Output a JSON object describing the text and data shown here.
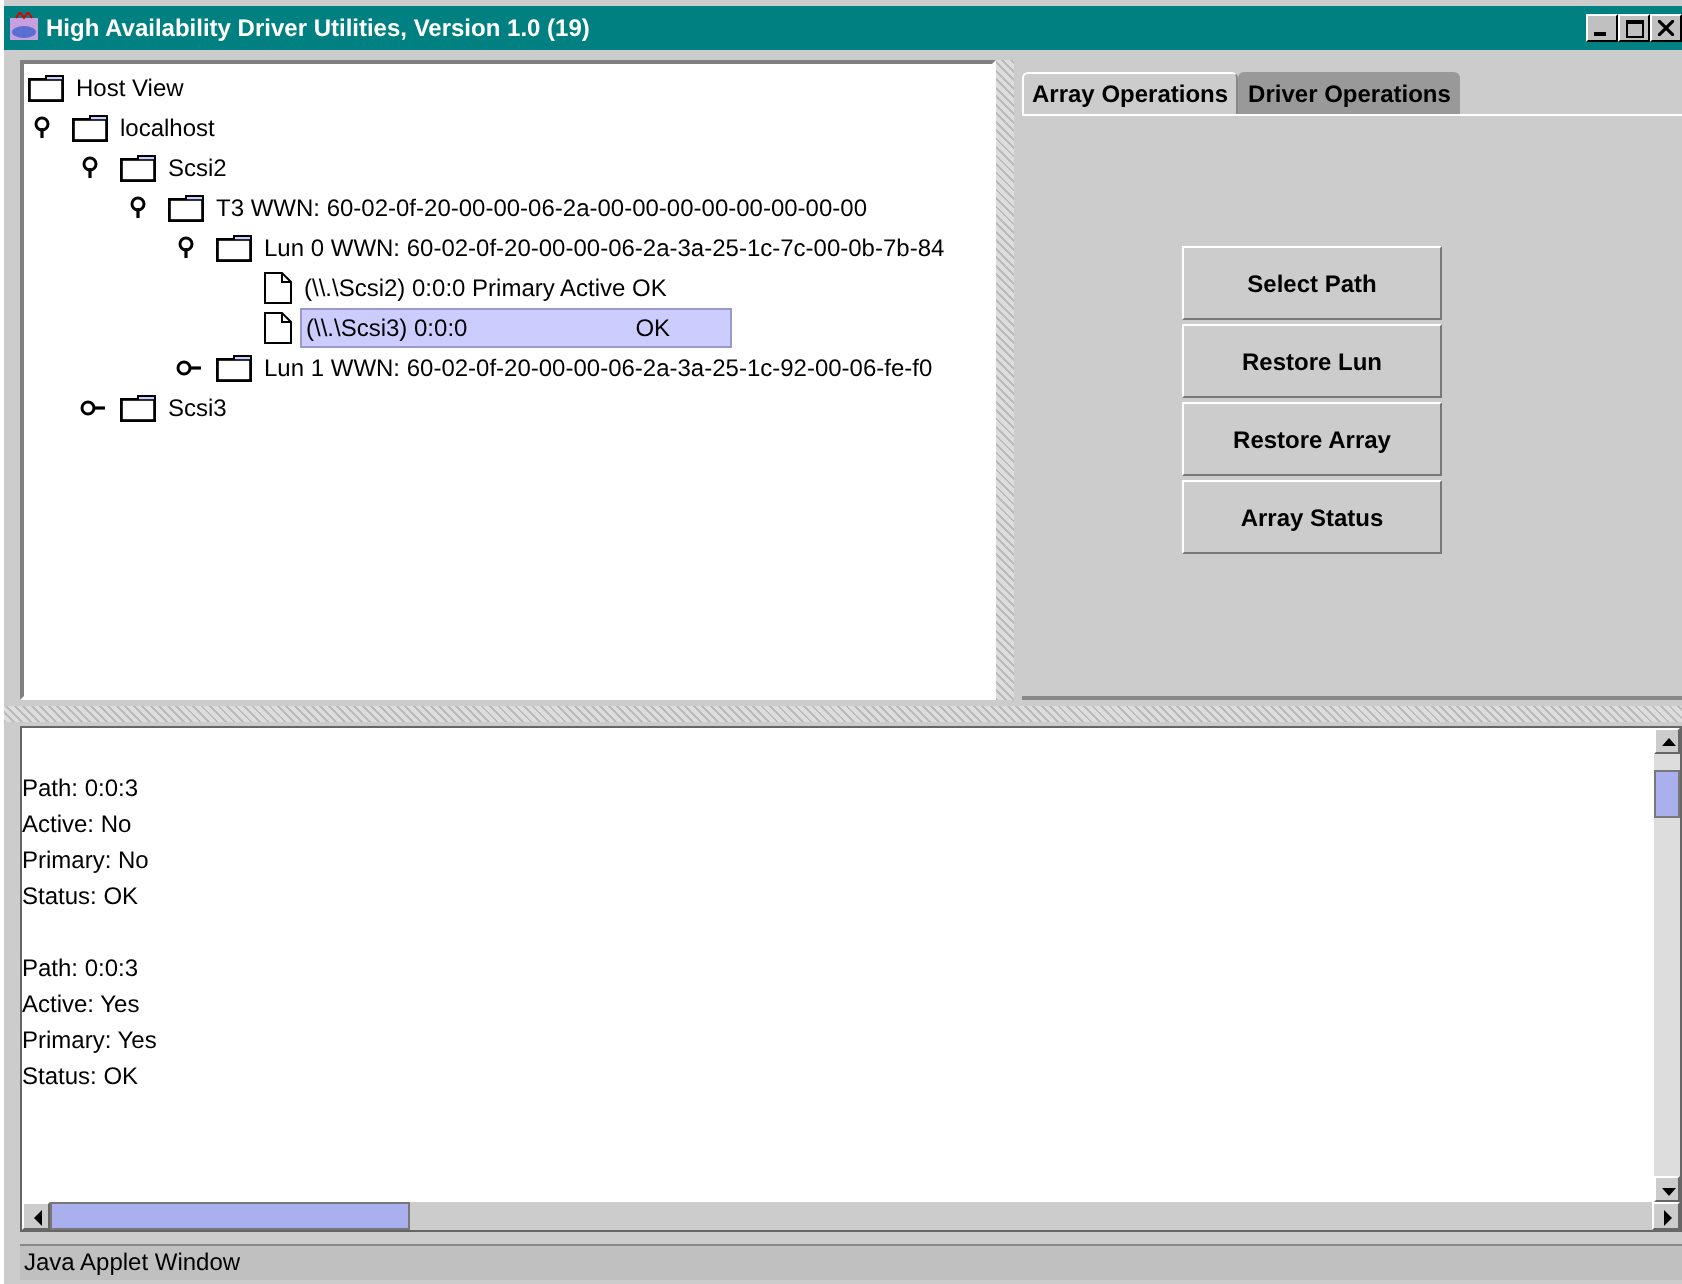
{
  "window": {
    "title": "High Availability Driver Utilities, Version 1.0 (19)"
  },
  "tree": [
    {
      "kind": "folder",
      "label": "Host View",
      "children": [
        {
          "kind": "folder",
          "label": "localhost",
          "expanded": true,
          "children": [
            {
              "kind": "folder",
              "label": "Scsi2",
              "expanded": true,
              "children": [
                {
                  "kind": "folder",
                  "label": "T3  WWN:  60-02-0f-20-00-00-06-2a-00-00-00-00-00-00-00-00",
                  "expanded": true,
                  "children": [
                    {
                      "kind": "folder",
                      "label": "Lun 0 WWN:  60-02-0f-20-00-00-06-2a-3a-25-1c-7c-00-0b-7b-84",
                      "expanded": true,
                      "children": [
                        {
                          "kind": "file",
                          "label": "(\\\\.\\Scsi2)  0:0:0 Primary Active OK",
                          "selected": false
                        },
                        {
                          "kind": "file",
                          "label": "(\\\\.\\Scsi3)  0:0:0",
                          "status": "OK",
                          "selected": true
                        }
                      ]
                    },
                    {
                      "kind": "folder",
                      "label": "Lun 1 WWN:  60-02-0f-20-00-00-06-2a-3a-25-1c-92-00-06-fe-f0",
                      "expanded": false
                    }
                  ]
                }
              ]
            },
            {
              "kind": "folder",
              "label": "Scsi3",
              "expanded": false
            }
          ]
        }
      ]
    }
  ],
  "tabs": [
    {
      "label": "Array Operations",
      "selected": true
    },
    {
      "label": "Driver Operations",
      "selected": false
    }
  ],
  "buttons": [
    "Select Path",
    "Restore Lun",
    "Restore Array",
    "Array Status"
  ],
  "output": [
    [
      "Path: 0:0:3",
      "Active: No",
      "Primary: No",
      "Status: OK"
    ],
    [
      "Path: 0:0:3",
      "Active: Yes",
      "Primary: Yes",
      "Status: OK"
    ]
  ],
  "status_bar": "Java Applet Window"
}
